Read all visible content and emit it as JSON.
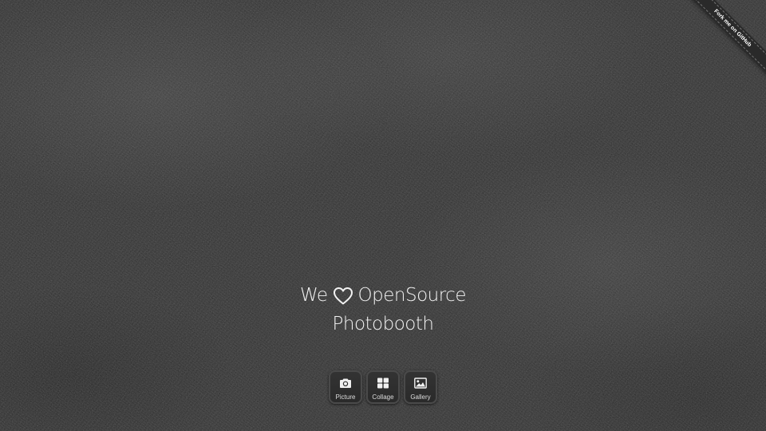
{
  "ribbon": {
    "label": "Fork me on GitHub"
  },
  "title": {
    "prefix": "We",
    "icon": "heart-icon",
    "suffix": "OpenSource",
    "line2": "Photobooth"
  },
  "buttons": [
    {
      "label": "Picture",
      "icon": "camera-icon"
    },
    {
      "label": "Collage",
      "icon": "grid-icon"
    },
    {
      "label": "Gallery",
      "icon": "image-icon"
    }
  ],
  "colors": {
    "background": "#2f2f2f",
    "text": "#f2f2f2",
    "button_border": "#4a4a4a"
  }
}
